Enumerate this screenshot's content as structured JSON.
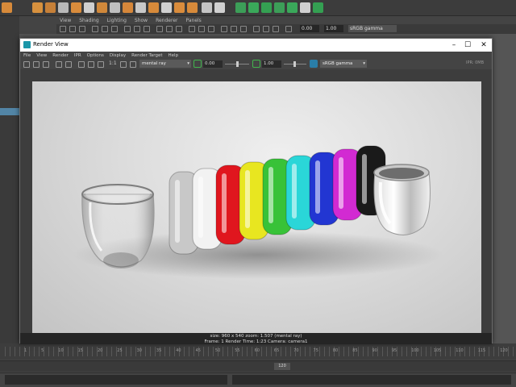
{
  "maya": {
    "viewport_menu": [
      "View",
      "Shading",
      "Lighting",
      "Show",
      "Renderer",
      "Panels"
    ],
    "viewport_exposure": "0.00",
    "viewport_gamma_value": "1.00",
    "viewport_colorspace": "sRGB gamma",
    "timeline_ticks": [
      "1",
      "5",
      "10",
      "15",
      "20",
      "25",
      "30",
      "35",
      "40",
      "45",
      "50",
      "55",
      "60",
      "65",
      "70",
      "75",
      "80",
      "85",
      "90",
      "95",
      "100",
      "105",
      "110",
      "115",
      "120"
    ],
    "range_end": "120"
  },
  "render_view": {
    "title": "Render View",
    "menu": [
      "File",
      "View",
      "Render",
      "IPR",
      "Options",
      "Display",
      "Render Target",
      "Help"
    ],
    "ratio_label": "1:1",
    "renderer": "mental ray",
    "exposure": "0.00",
    "gamma": "1.00",
    "colorspace": "sRGB gamma",
    "ipr_label": "IPR: 0MB",
    "info_line1": "size: 960 x 540  zoom: 1.507          (mental ray)",
    "info_line2": "Frame: 1       Render Time: 1:23        Camera: camera1"
  },
  "colors": {
    "accent": "#5285a6",
    "ring_colors": [
      "#c8c8c8",
      "#f2f2f2",
      "#e0161e",
      "#e8e620",
      "#38c238",
      "#2ad6d8",
      "#2236d2",
      "#d22ad2",
      "#1a1a1a"
    ]
  }
}
